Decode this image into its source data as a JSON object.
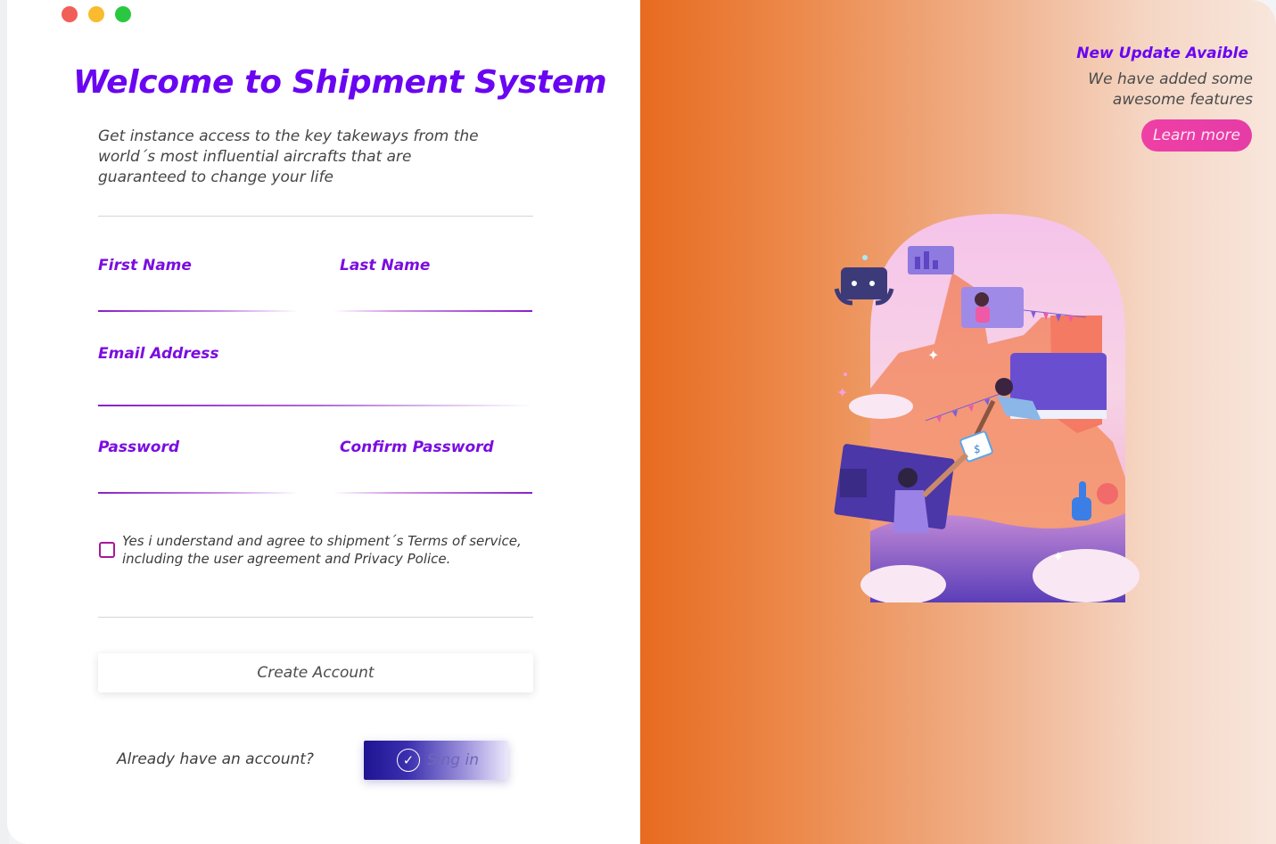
{
  "window": {
    "controls": [
      "close",
      "minimize",
      "maximize"
    ]
  },
  "form": {
    "title": "Welcome to Shipment System",
    "subtitle": "Get instance access to the key takeways from the\nworld´s most influential aircrafts that are\nguaranteed to change your life",
    "fields": {
      "first_name": {
        "label": "First Name",
        "value": ""
      },
      "last_name": {
        "label": "Last Name",
        "value": ""
      },
      "email": {
        "label": "Email Address",
        "value": ""
      },
      "password": {
        "label": "Password",
        "value": ""
      },
      "confirm_password": {
        "label": "Confirm Password",
        "value": ""
      }
    },
    "terms": {
      "checked": false,
      "text": "Yes i understand and agree to shipment´s Terms of service,\nincluding the user agreement and Privacy Police."
    },
    "create_account_label": "Create Account",
    "already_text": "Already have an account?",
    "signin_label": "Sing in"
  },
  "promo": {
    "title": "New Update Avaible",
    "text": "We have added some\nawesome features",
    "learn_more_label": "Learn more",
    "illustration": "people-exchanging-package-illustration"
  },
  "colors": {
    "accent": "#6a05f2",
    "label": "#7b0de0",
    "promo_gradient_start": "#e76b20",
    "promo_gradient_end": "#f8e6dc",
    "learn_more": "#ee3fa5",
    "signin": "#1d1492"
  }
}
